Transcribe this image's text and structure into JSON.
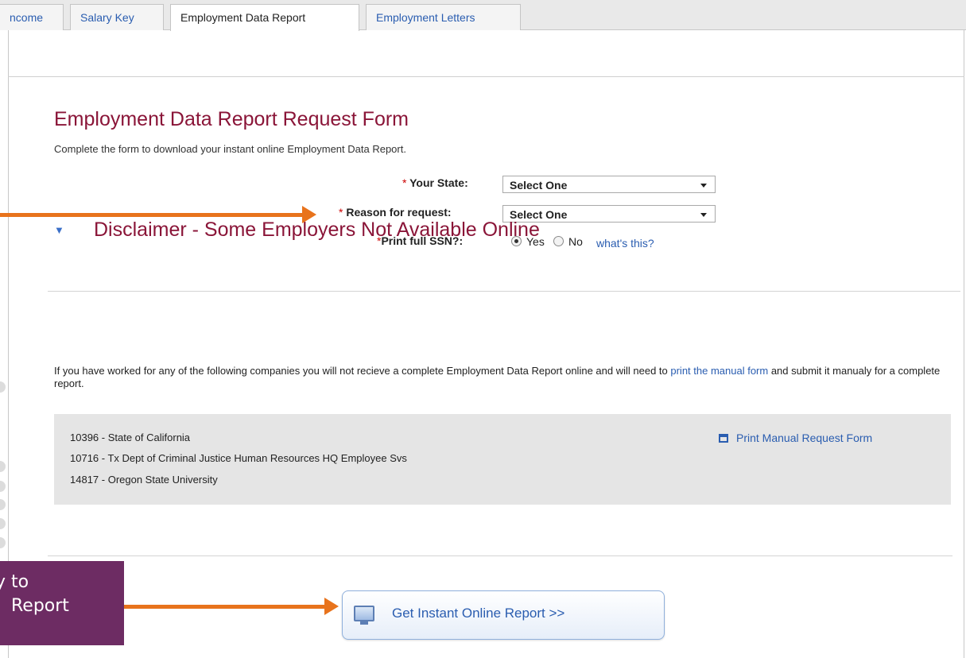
{
  "tabs": [
    {
      "label": "ncome",
      "active": false
    },
    {
      "label": "Salary Key",
      "active": false
    },
    {
      "label": "Employment Data Report",
      "active": true
    },
    {
      "label": "Employment Letters",
      "active": false
    }
  ],
  "form": {
    "title": "Employment Data Report Request Form",
    "subtitle": "Complete the form to download your instant online Employment Data Report.",
    "state_label": "Your State:",
    "state_value": "Select One",
    "reason_label": "Reason for request:",
    "reason_value": "Select One",
    "ssn_label": "Print full SSN?:",
    "ssn_yes": "Yes",
    "ssn_no": "No",
    "ssn_selected": "Yes",
    "whats_this": "what's this?",
    "required_mark": "*"
  },
  "disclaimer": {
    "title": "Disclaimer - Some Employers Not Available Online",
    "text_before": "If you have worked for any of the following companies you will not recieve a complete Employment Data Report online and will need to ",
    "link_text": "print the manual form",
    "text_after": " and submit it manualy for a complete report.",
    "companies": [
      "10396 - State of California",
      "10716 - Tx Dept of Criminal Justice Human Resources HQ Employee Svs",
      "14817 - Oregon State University"
    ],
    "print_link": "Print Manual Request Form"
  },
  "report_button": "Get Instant Online Report >>",
  "callout": {
    "line1": "y to",
    "line2": "Report"
  },
  "colors": {
    "heading": "#8a1538",
    "link": "#2a5db0",
    "arrow": "#e8731c",
    "callout_bg": "#6d2c63"
  }
}
